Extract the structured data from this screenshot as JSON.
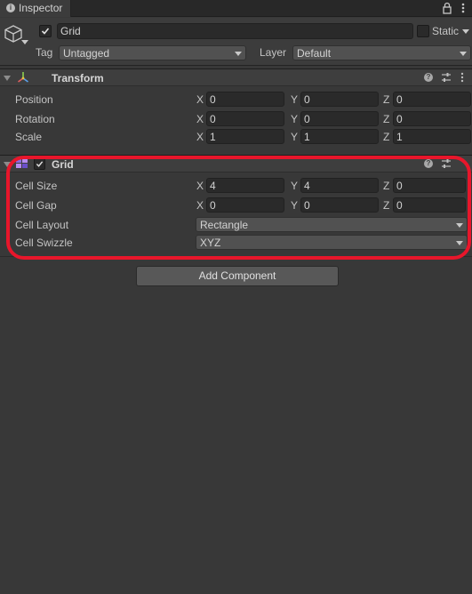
{
  "tab": {
    "title": "Inspector",
    "info_icon": "info-icon",
    "lock_icon": "lock-icon",
    "menu_icon": "kebab-menu-icon"
  },
  "header": {
    "object_active": true,
    "object_name": "Grid",
    "static_label": "Static",
    "tag_label": "Tag",
    "tag_value": "Untagged",
    "layer_label": "Layer",
    "layer_value": "Default"
  },
  "transform": {
    "title": "Transform",
    "rows": [
      {
        "label": "Position",
        "x": "0",
        "y": "0",
        "z": "0"
      },
      {
        "label": "Rotation",
        "x": "0",
        "y": "0",
        "z": "0"
      },
      {
        "label": "Scale",
        "x": "1",
        "y": "1",
        "z": "1"
      }
    ]
  },
  "grid": {
    "title": "Grid",
    "enabled": true,
    "cell_size": {
      "label": "Cell Size",
      "x": "4",
      "y": "4",
      "z": "0"
    },
    "cell_gap": {
      "label": "Cell Gap",
      "x": "0",
      "y": "0",
      "z": "0"
    },
    "cell_layout": {
      "label": "Cell Layout",
      "value": "Rectangle"
    },
    "cell_swizzle": {
      "label": "Cell Swizzle",
      "value": "XYZ"
    }
  },
  "axes": {
    "x": "X",
    "y": "Y",
    "z": "Z"
  },
  "add_component_label": "Add Component",
  "colors": {
    "background": "#383838",
    "highlight": "#e8162b",
    "field": "#2a2a2a"
  }
}
